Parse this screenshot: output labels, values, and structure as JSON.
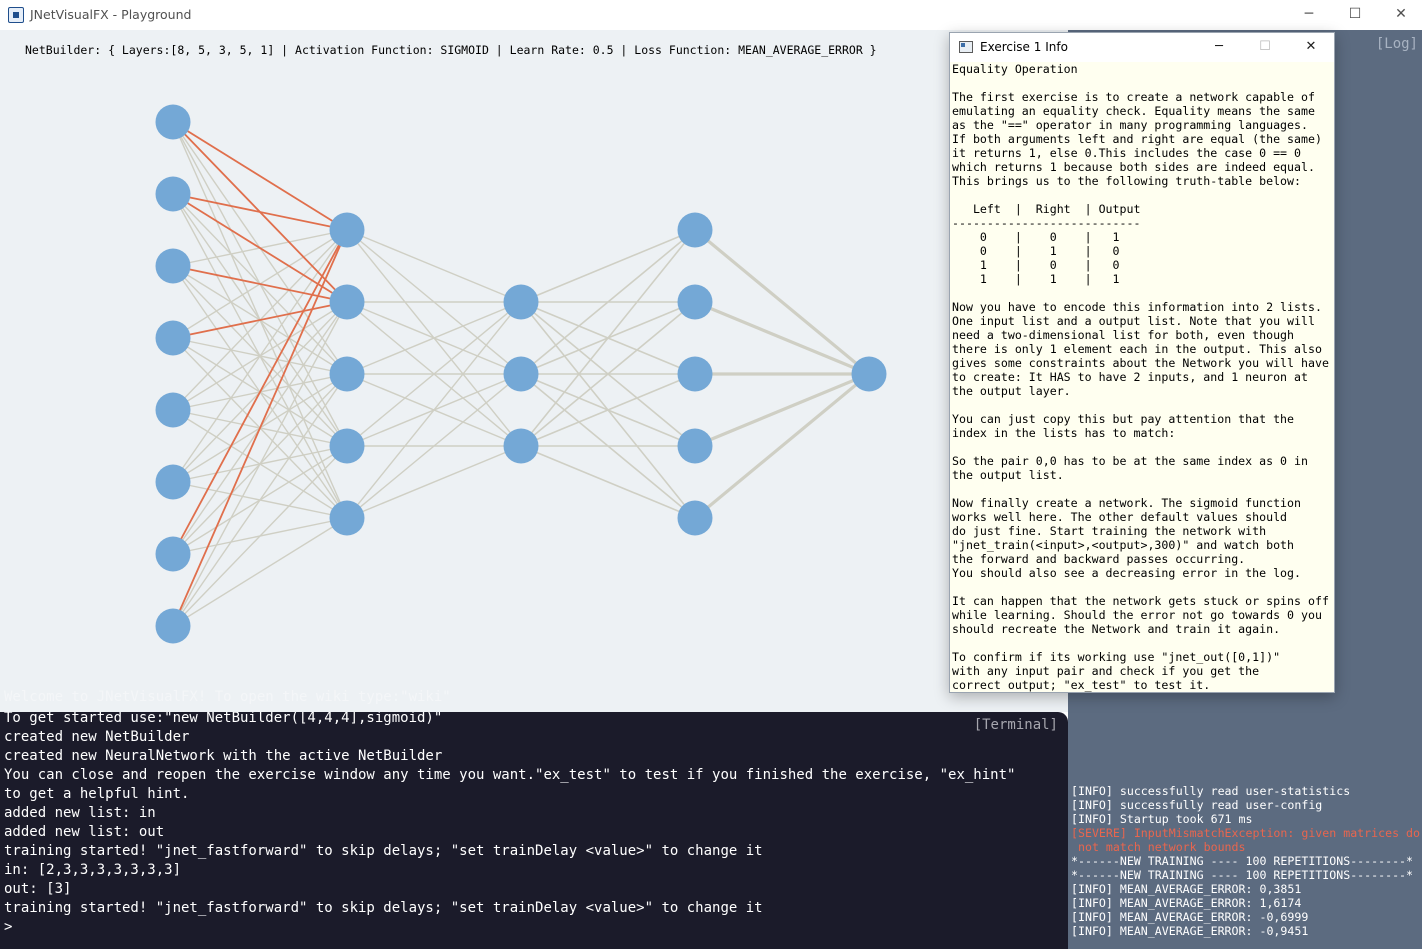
{
  "window": {
    "title": "JNetVisualFX - Playground",
    "minimize_glyph": "─",
    "maximize_glyph": "☐",
    "close_glyph": "✕"
  },
  "canvas": {
    "netbuilder_info": "NetBuilder: { Layers:[8, 5, 3, 5, 1] | Activation Function: SIGMOID | Learn Rate: 0.5 | Loss Function: MEAN_AVERAGE_ERROR }",
    "welcome_line": "Welcome to JNetVisualFX! To open the wiki type:\"wiki\"",
    "network": {
      "layers": [
        8,
        5,
        3,
        5,
        1
      ],
      "node_color": "#74a8d6",
      "edge_color": "#cfcfc4",
      "active_edge_color": "#e06f4c"
    }
  },
  "log": {
    "label": "[Log]",
    "lines": [
      {
        "text": "[INFO] successfully read user-statistics",
        "level": "info"
      },
      {
        "text": "[INFO] successfully read user-config",
        "level": "info"
      },
      {
        "text": "[INFO] Startup took 671 ms",
        "level": "info"
      },
      {
        "text": "[SEVERE] InputMismatchException: given matrices do",
        "level": "severe"
      },
      {
        "text": " not match network bounds",
        "level": "severe"
      },
      {
        "text": "*------NEW TRAINING ---- 100 REPETITIONS--------*",
        "level": "info"
      },
      {
        "text": "*------NEW TRAINING ---- 100 REPETITIONS--------*",
        "level": "info"
      },
      {
        "text": "[INFO] MEAN_AVERAGE_ERROR: 0,3851",
        "level": "info"
      },
      {
        "text": "[INFO] MEAN_AVERAGE_ERROR: 1,6174",
        "level": "info"
      },
      {
        "text": "[INFO] MEAN_AVERAGE_ERROR: -0,6999",
        "level": "info"
      },
      {
        "text": "[INFO] MEAN_AVERAGE_ERROR: -0,9451",
        "level": "info"
      }
    ],
    "info_color": "#ffffff",
    "severe_color": "#e8664e"
  },
  "terminal": {
    "label": "[Terminal]",
    "lines": [
      "To get started use:\"new NetBuilder([4,4,4],sigmoid)\"",
      "created new NetBuilder",
      "created new NeuralNetwork with the active NetBuilder",
      "You can close and reopen the exercise window any time you want.\"ex_test\" to test if you finished the exercise, \"ex_hint\"",
      "to get a helpful hint.",
      "added new list: in",
      "added new list: out",
      "training started! \"jnet_fastforward\" to skip delays; \"set trainDelay <value>\" to change it",
      "in: [2,3,3,3,3,3,3,3]",
      "out: [3]",
      "training started! \"jnet_fastforward\" to skip delays; \"set trainDelay <value>\" to change it",
      ">"
    ]
  },
  "exercise_window": {
    "title": "Exercise 1 Info",
    "minimize_glyph": "─",
    "maximize_glyph": "☐",
    "close_glyph": "✕",
    "text_lines": [
      "Equality Operation",
      "",
      "The first exercise is to create a network capable of",
      "emulating an equality check. Equality means the same",
      "as the \"==\" operator in many programming languages.",
      "If both arguments left and right are equal (the same)",
      "it returns 1, else 0.This includes the case 0 == 0",
      "which returns 1 because both sides are indeed equal.",
      "This brings us to the following truth-table below:",
      "",
      "   Left  |  Right  | Output",
      "---------------------------",
      "    0    |    0    |   1",
      "    0    |    1    |   0",
      "    1    |    0    |   0",
      "    1    |    1    |   1",
      "",
      "Now you have to encode this information into 2 lists.",
      "One input list and a output list. Note that you will",
      "need a two-dimensional list for both, even though",
      "there is only 1 element each in the output. This also",
      "gives some constraints about the Network you will have",
      "to create: It HAS to have 2 inputs, and 1 neuron at",
      "the output layer.",
      "",
      "You can just copy this but pay attention that the",
      "index in the lists has to match:",
      "",
      "So the pair 0,0 has to be at the same index as 0 in",
      "the output list.",
      "",
      "Now finally create a network. The sigmoid function",
      "works well here. The other default values should",
      "do just fine. Start training the network with",
      "\"jnet_train(<input>,<output>,300)\" and watch both",
      "the forward and backward passes occurring.",
      "You should also see a decreasing error in the log.",
      "",
      "It can happen that the network gets stuck or spins off",
      "while learning. Should the error not go towards 0 you",
      "should recreate the Network and train it again.",
      "",
      "To confirm if its working use \"jnet_out([0,1])\"",
      "with any input pair and check if you get the",
      "correct output; \"ex_test\" to test it."
    ]
  }
}
